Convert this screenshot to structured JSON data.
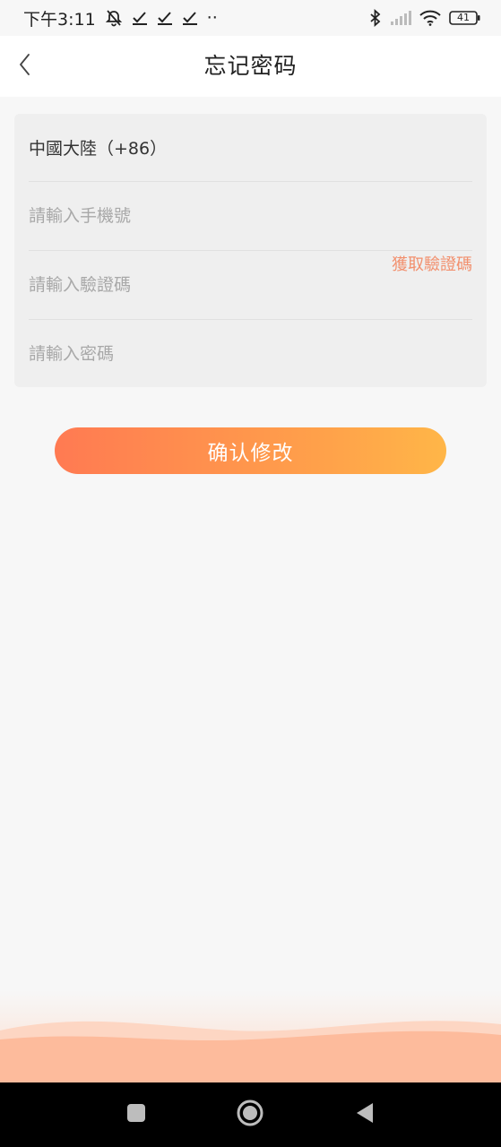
{
  "status_bar": {
    "time": "下午3:11",
    "battery": "41",
    "more_dots": "··"
  },
  "nav": {
    "title": "忘记密码",
    "back_icon": "chevron-left-icon"
  },
  "form": {
    "country": "中國大陸（+86）",
    "phone_placeholder": "請輸入手機號",
    "code_placeholder": "請輸入驗證碼",
    "get_code_label": "獲取驗證碼",
    "password_placeholder": "請輸入密碼"
  },
  "actions": {
    "confirm_label": "确认修改"
  },
  "colors": {
    "accent_start": "#ff7a52",
    "accent_end": "#ffb648",
    "get_code": "#f2906e",
    "wave": "#fdbb9c"
  }
}
